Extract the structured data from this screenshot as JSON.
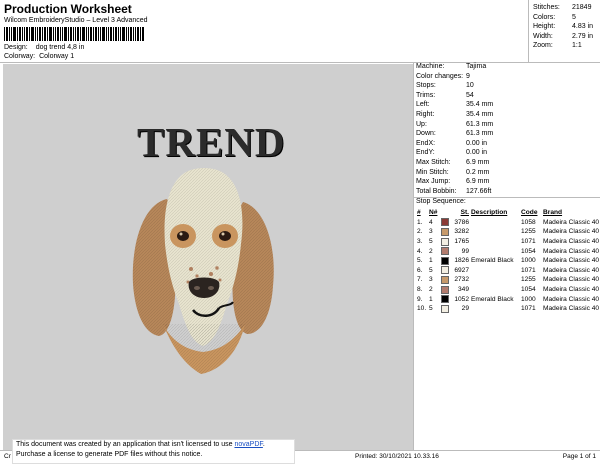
{
  "header": {
    "title": "Production Worksheet",
    "subtitle": "Wilcom EmbroideryStudio – Level 3 Advanced",
    "design_label": "Design:",
    "design_value": "dog  trend 4,8 in",
    "colorway_label": "Colorway:",
    "colorway_value": "Colorway 1"
  },
  "stats": [
    {
      "k": "Stitches:",
      "v": "21849"
    },
    {
      "k": "Colors:",
      "v": "5"
    },
    {
      "k": "Height:",
      "v": "4.83 in"
    },
    {
      "k": "Width:",
      "v": "2.79 in"
    },
    {
      "k": "Zoom:",
      "v": "1:1"
    }
  ],
  "canvas": {
    "text": "TREND"
  },
  "machine": [
    {
      "k": "Machine:",
      "v": "Tajima"
    },
    {
      "k": "Color changes:",
      "v": "9"
    },
    {
      "k": "Stops:",
      "v": "10"
    },
    {
      "k": "Trims:",
      "v": "54"
    },
    {
      "k": "Left:",
      "v": "35.4 mm"
    },
    {
      "k": "Right:",
      "v": "35.4 mm"
    },
    {
      "k": "Up:",
      "v": "61.3 mm"
    },
    {
      "k": "Down:",
      "v": "61.3 mm"
    },
    {
      "k": "EndX:",
      "v": "0.00 in"
    },
    {
      "k": "EndY:",
      "v": "0.00 in"
    },
    {
      "k": "Max Stitch:",
      "v": "6.9 mm"
    },
    {
      "k": "Min Stitch:",
      "v": "0.2 mm"
    },
    {
      "k": "Max Jump:",
      "v": "6.9 mm"
    },
    {
      "k": "Total Bobbin:",
      "v": "127.66ft"
    }
  ],
  "stop_sequence": {
    "title": "Stop Sequence:",
    "headers": [
      "#",
      "N#",
      "",
      "St.",
      "Description",
      "Code",
      "Brand"
    ],
    "rows": [
      {
        "n": "1.",
        "c": "4",
        "color": "#8a3a35",
        "st": "3786",
        "desc": "",
        "code": "1058",
        "brand": "Madeira Classic 40"
      },
      {
        "n": "2.",
        "c": "3",
        "color": "#c79a6b",
        "st": "3282",
        "desc": "",
        "code": "1255",
        "brand": "Madeira Classic 40"
      },
      {
        "n": "3.",
        "c": "5",
        "color": "#f3efe3",
        "st": "1765",
        "desc": "",
        "code": "1071",
        "brand": "Madeira Classic 40"
      },
      {
        "n": "4.",
        "c": "2",
        "color": "#b37c6e",
        "st": "99",
        "desc": "",
        "code": "1054",
        "brand": "Madeira Classic 40"
      },
      {
        "n": "5.",
        "c": "1",
        "color": "#000000",
        "st": "1826",
        "desc": "Emerald Black",
        "code": "1000",
        "brand": "Madeira Classic 40"
      },
      {
        "n": "6.",
        "c": "5",
        "color": "#f3efe3",
        "st": "6927",
        "desc": "",
        "code": "1071",
        "brand": "Madeira Classic 40"
      },
      {
        "n": "7.",
        "c": "3",
        "color": "#c79a6b",
        "st": "2732",
        "desc": "",
        "code": "1255",
        "brand": "Madeira Classic 40"
      },
      {
        "n": "8.",
        "c": "2",
        "color": "#b37c6e",
        "st": "349",
        "desc": "",
        "code": "1054",
        "brand": "Madeira Classic 40"
      },
      {
        "n": "9.",
        "c": "1",
        "color": "#000000",
        "st": "1052",
        "desc": "Emerald Black",
        "code": "1000",
        "brand": "Madeira Classic 40"
      },
      {
        "n": "10.",
        "c": "5",
        "color": "#f3efe3",
        "st": "29",
        "desc": "",
        "code": "1071",
        "brand": "Madeira Classic 40"
      }
    ]
  },
  "footer": {
    "left": "Cr",
    "printed": "Printed: 30/10/2021 10.33.16",
    "page": "Page 1 of 1"
  },
  "notice": {
    "line1": "This document was created by an application that isn't licensed to use",
    "link": "novaPDF",
    "line1_end": ".",
    "line2": "Purchase a license to generate PDF files without this notice."
  }
}
